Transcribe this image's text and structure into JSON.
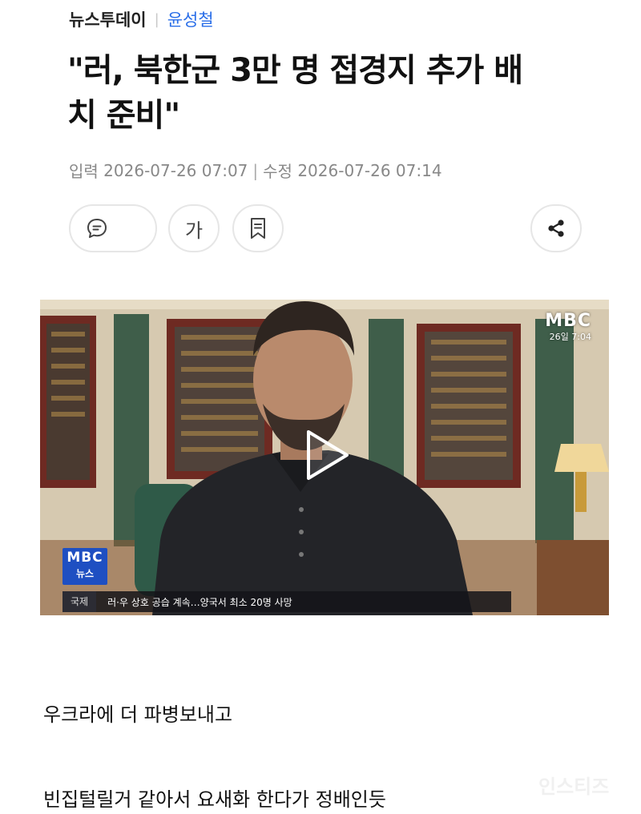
{
  "header": {
    "source": "뉴스투데이",
    "separator": "|",
    "reporter": "윤성철"
  },
  "article": {
    "title_line1": "\"러, 북한군 3만 명 접경지 추가 배",
    "title_line2": "치 준비\"",
    "input_label": "입력",
    "input_time": "2026-07-26 07:07",
    "ts_separator": "|",
    "modified_label": "수정",
    "modified_time": "2026-07-26 07:14"
  },
  "toolbar": {
    "comment_icon": "comment-icon",
    "font_label": "가",
    "bookmark_icon": "bookmark-icon",
    "share_icon": "share-icon"
  },
  "video": {
    "corner_logo": "MBC",
    "corner_date": "26일 7:04",
    "news_logo_top": "MBC",
    "news_logo_bottom": "뉴스",
    "ticker_category": "국제",
    "ticker_text": "러·우 상호 공습 계속…양국서 최소 20명 사망",
    "play_icon": "play-icon"
  },
  "body": {
    "paragraph1": "우크라에 더 파병보내고",
    "paragraph2": "빈집털릴거 같아서 요새화 한다가 정배인듯"
  },
  "watermark": "인스티즈",
  "colors": {
    "reporter_link": "#2a6ee8",
    "news_logo_bg": "#1e4fc2",
    "timestamp_gray": "#888888"
  }
}
